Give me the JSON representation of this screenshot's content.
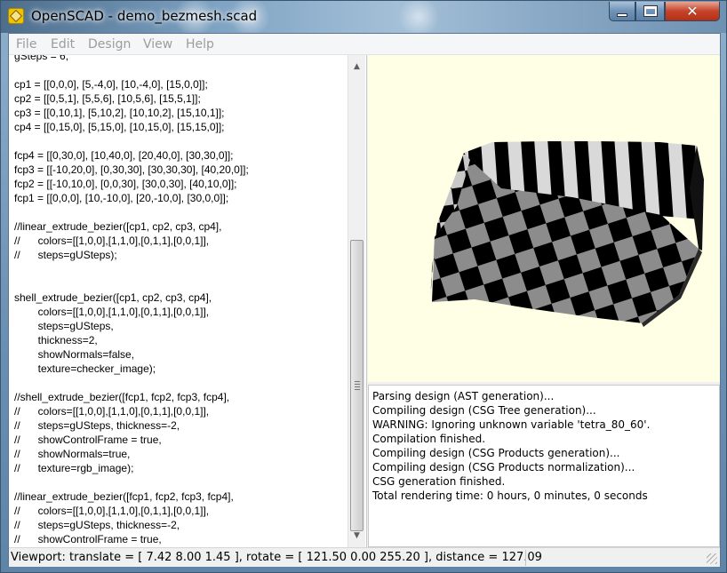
{
  "window": {
    "title": "OpenSCAD - demo_bezmesh.scad",
    "icon": "openscad-app-icon"
  },
  "menu": [
    "File",
    "Edit",
    "Design",
    "View",
    "Help"
  ],
  "editor": {
    "lines": [
      "gSteps = 6;",
      "",
      "cp1 = [[0,0,0], [5,-4,0], [10,-4,0], [15,0,0]];",
      "cp2 = [[0,5,1], [5,5,6], [10,5,6], [15,5,1]];",
      "cp3 = [[0,10,1], [5,10,2], [10,10,2], [15,10,1]];",
      "cp4 = [[0,15,0], [5,15,0], [10,15,0], [15,15,0]];",
      "",
      "fcp4 = [[0,30,0], [10,40,0], [20,40,0], [30,30,0]];",
      "fcp3 = [[-10,20,0], [0,30,30], [30,30,30], [40,20,0]];",
      "fcp2 = [[-10,10,0], [0,0,30], [30,0,30], [40,10,0]];",
      "fcp1 = [[0,0,0], [10,-10,0], [20,-10,0], [30,0,0]];",
      "",
      "//linear_extrude_bezier([cp1, cp2, cp3, cp4],",
      "//      colors=[[1,0,0],[1,1,0],[0,1,1],[0,0,1]],",
      "//      steps=gUSteps);",
      "",
      "",
      "shell_extrude_bezier([cp1, cp2, cp3, cp4],",
      "        colors=[[1,0,0],[1,1,0],[0,1,1],[0,0,1]],",
      "        steps=gUSteps,",
      "        thickness=2,",
      "        showNormals=false,",
      "        texture=checker_image);",
      "",
      "//shell_extrude_bezier([fcp1, fcp2, fcp3, fcp4],",
      "//      colors=[[1,0,0],[1,1,0],[0,1,1],[0,0,1]],",
      "//      steps=gUSteps, thickness=-2,",
      "//      showControlFrame = true,",
      "//      showNormals=true,",
      "//      texture=rgb_image);",
      "",
      "//linear_extrude_bezier([fcp1, fcp2, fcp3, fcp4],",
      "//      colors=[[1,0,0],[1,1,0],[0,1,1],[0,0,1]],",
      "//      steps=gUSteps, thickness=-2,",
      "//      showControlFrame = true,"
    ]
  },
  "console": {
    "lines": [
      "Parsing design (AST generation)...",
      "Compiling design (CSG Tree generation)...",
      "WARNING: Ignoring unknown variable 'tetra_80_60'.",
      "Compilation finished.",
      "Compiling design (CSG Products generation)...",
      "Compiling design (CSG Products normalization)...",
      "CSG generation finished.",
      "Total rendering time: 0 hours, 0 minutes, 0 seconds"
    ]
  },
  "status": {
    "viewport": "Viewport: translate = [ 7.42 8.00 1.45 ], rotate = [ 121.50 0.00 255.20 ], distance = 127.09"
  },
  "colors": {
    "viewport_bg": "#ffffe5",
    "checker_dark": "#000000",
    "checker_light": "#8c8c8c",
    "menu_disabled": "#9c9c9c"
  }
}
